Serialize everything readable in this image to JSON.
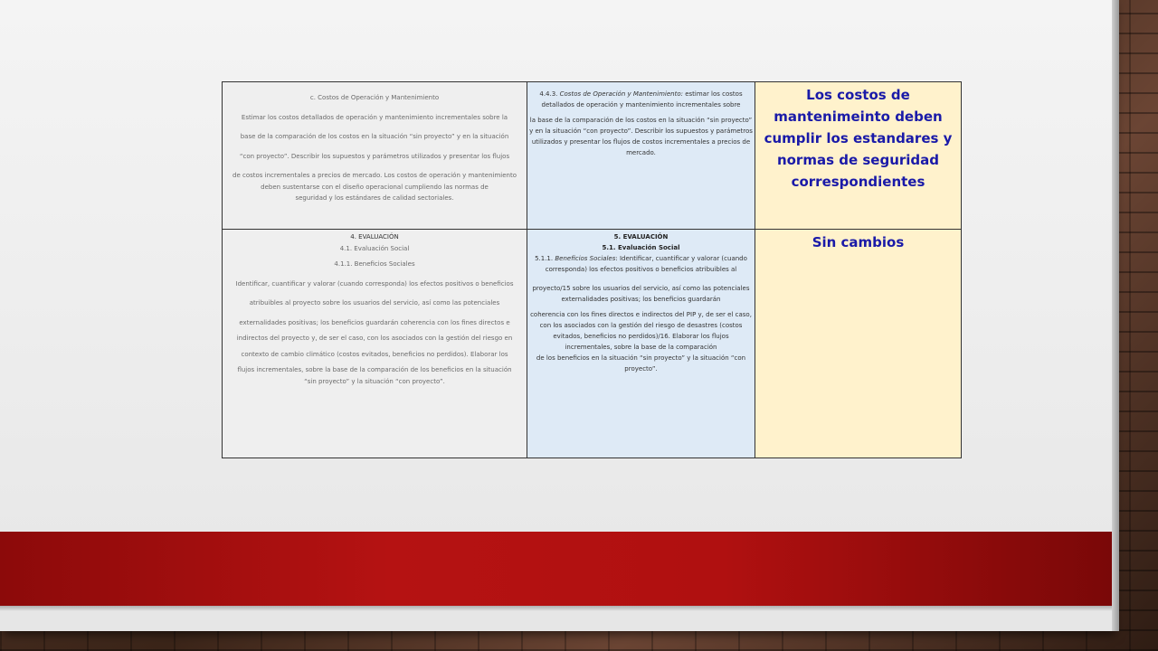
{
  "table": {
    "row1": {
      "col1": [
        "c. Costos de Operación y Mantenimiento",
        "Estimar los costos detallados de operación y mantenimiento incrementales sobre la",
        "base de la comparación de los costos en la situación “sin proyecto” y en la situación",
        "“con proyecto”. Describir los supuestos y parámetros utilizados y presentar los flujos",
        "de costos incrementales a precios de mercado. Los costos de operación y mantenimiento deben sustentarse con el diseño operacional cumpliendo las normas de",
        "seguridad y los estándares de calidad sectoriales."
      ],
      "col2": {
        "heading_prefix": "4.4.3. ",
        "heading_italic": "Costos de Operación y Mantenimiento:",
        "heading_rest": " estimar los costos detallados de operación y mantenimiento incrementales sobre",
        "body": "la base de la comparación de los costos en la situación “sin proyecto” y en la situación “con proyecto”. Describir los supuestos y parámetros utilizados y presentar los flujos de costos incrementales a precios de mercado."
      },
      "col3": "Los costos de mantenimeinto deben cumplir los estandares y normas de seguridad correspondientes"
    },
    "row2": {
      "col1": [
        "4. EVALUACIÓN",
        "4.1. Evaluación Social",
        "4.1.1. Beneficios Sociales",
        "Identificar, cuantificar y valorar (cuando corresponda) los efectos positivos o beneficios",
        "atribuibles al proyecto sobre los usuarios del servicio, así como las potenciales",
        "externalidades positivas; los beneficios guardarán coherencia con los fines directos e",
        "indirectos del proyecto y, de ser el caso, con los asociados con la gestión del riesgo en",
        "contexto de cambio climático (costos evitados, beneficios no perdidos). Elaborar los",
        "flujos incrementales, sobre la base de la comparación de los beneficios en la situación",
        "“sin proyecto” y la situación “con proyecto”."
      ],
      "col2": {
        "heading1": "5. EVALUACIÓN",
        "heading2": "5.1. Evaluación Social",
        "item_prefix": "5.1.1. ",
        "item_italic": "Beneficios Sociales",
        "item_rest": ": Identificar, cuantificar y valorar (cuando corresponda) los efectos positivos o beneficios atribuibles al",
        "para1": "proyecto/15 sobre los usuarios del servicio, así como las potenciales externalidades positivas; los beneficios guardarán",
        "para2": "coherencia con los fines directos e indirectos del PIP y, de ser el caso, con los asociados con la gestión del riesgo de desastres (costos evitados, beneficios no perdidos)/16. Elaborar los flujos incrementales, sobre la base de la comparación",
        "para3": "de los beneficios en la situación “sin proyecto” y la situación “con proyecto”."
      },
      "col3": "Sin cambios"
    }
  },
  "colors": {
    "col1_bg": "#efefef",
    "col2_bg": "#deeaf6",
    "col3_bg": "#fff2cc",
    "col3_text": "#1a1aa8",
    "band": "#b51212"
  }
}
